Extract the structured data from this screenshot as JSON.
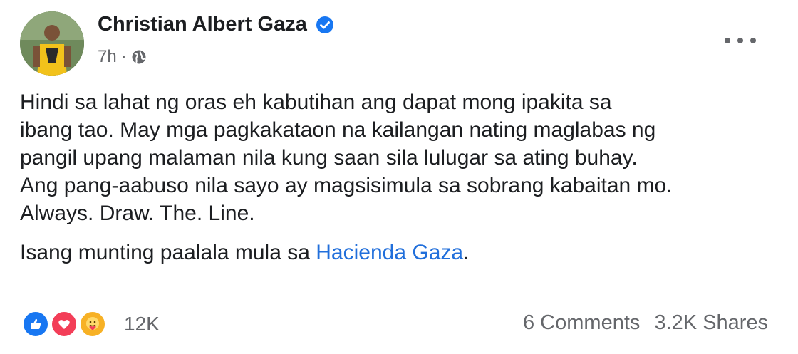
{
  "post": {
    "author": "Christian Albert Gaza",
    "time": "7h",
    "separator": "·",
    "body_line_1": "Hindi sa lahat ng oras eh kabutihan ang dapat mong ipakita sa",
    "body_line_2": "ibang tao. May mga pagkakataon na kailangan nating maglabas ng",
    "body_line_3": "pangil upang malaman nila kung saan sila lulugar sa ating buhay.",
    "body_line_4": "Ang pang-aabuso nila sayo ay magsisimula sa sobrang kabaitan mo.",
    "body_line_5": "Always. Draw. The. Line.",
    "para2_before": "Isang munting paalala mula sa ",
    "para2_link": "Hacienda Gaza",
    "para2_after": "."
  },
  "engagement": {
    "reaction_count": "12K",
    "reaction_types": [
      "like",
      "love",
      "care"
    ],
    "comments": "6 Comments",
    "shares": "3.2K Shares"
  },
  "icons": {
    "verified": "verified-badge-icon",
    "audience": "globe-icon",
    "menu": "more-options-icon"
  },
  "colors": {
    "link": "#216fdb",
    "verified": "#1877f2",
    "like": "#1877f2",
    "love": "#f33e58",
    "care": "#f7b125"
  }
}
